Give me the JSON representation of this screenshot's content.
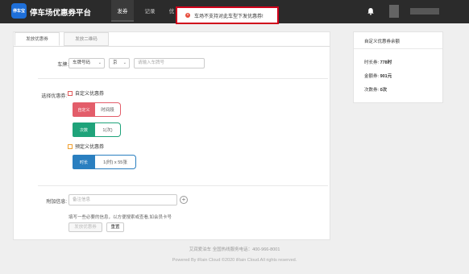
{
  "app": {
    "logo_text": "停车宝",
    "title": "停车场优惠券平台"
  },
  "nav": {
    "items": [
      "发券",
      "记录",
      "优"
    ]
  },
  "toast": {
    "message": "车场不支持对此车型下发优惠券!"
  },
  "tabs": [
    "发放优惠券",
    "发放二维码"
  ],
  "plate": {
    "label": "车牌:",
    "type_value": "车牌号码",
    "province_value": "京",
    "input_placeholder": "请输入车牌号"
  },
  "coupons": {
    "label": "选择优惠券:",
    "custom_head": "自定义优惠券",
    "preset_head": "预定义优惠券",
    "items": [
      {
        "tag": "自定义",
        "value": "时间段",
        "color": "#e35d6a"
      },
      {
        "tag": "次数",
        "value": "1(次)",
        "color": "#1fa37a"
      },
      {
        "tag": "时长",
        "value": "1(时) x 55张",
        "color": "#2a7fc0"
      }
    ]
  },
  "extra": {
    "label": "附加信息:",
    "placeholder": "备注信息",
    "hint": "填写一些必要的信息，以方便搜索或查看,如会员卡号"
  },
  "buttons": {
    "issue": "发放优惠券",
    "reset": "重置"
  },
  "balance": {
    "title": "自定义优惠券余额",
    "duration_label": "时长券:",
    "duration_value": "778时",
    "amount_label": "金额券:",
    "amount_value": "901元",
    "count_label": "次数券:",
    "count_value": "0次"
  },
  "footer": {
    "line1": "艾润爱泊车    全国热线服务电话：400-966-8001",
    "line2": "Powered By iRain Cloud ©2020 iRain Cloud.All rights reserved."
  }
}
